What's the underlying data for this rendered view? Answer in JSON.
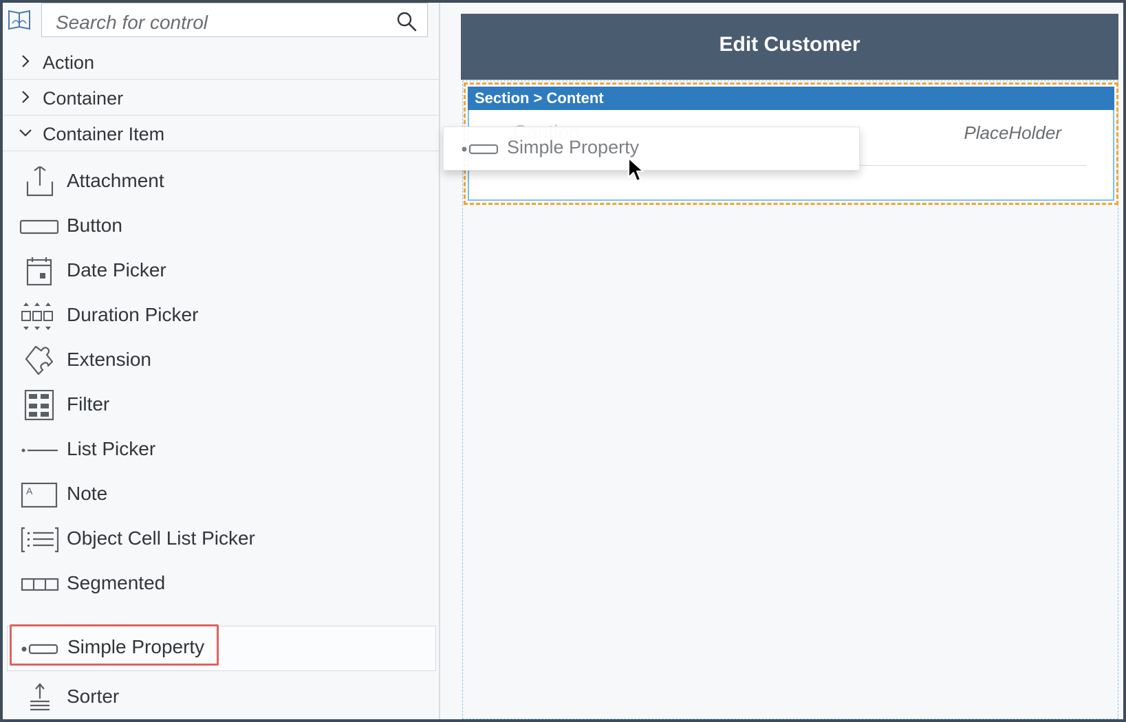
{
  "search": {
    "placeholder": "Search for control"
  },
  "categories": [
    {
      "label": "Action",
      "expanded": false
    },
    {
      "label": "Container",
      "expanded": false
    },
    {
      "label": "Container Item",
      "expanded": true
    }
  ],
  "items": [
    {
      "label": "Attachment",
      "icon": "upload-icon"
    },
    {
      "label": "Button",
      "icon": "button-icon"
    },
    {
      "label": "Date Picker",
      "icon": "calendar-icon"
    },
    {
      "label": "Duration Picker",
      "icon": "duration-picker-icon"
    },
    {
      "label": "Extension",
      "icon": "puzzle-icon"
    },
    {
      "label": "Filter",
      "icon": "grid-icon"
    },
    {
      "label": "List Picker",
      "icon": "list-picker-icon"
    },
    {
      "label": "Note",
      "icon": "note-icon"
    },
    {
      "label": "Object Cell List Picker",
      "icon": "object-cell-list-icon"
    },
    {
      "label": "Segmented",
      "icon": "segmented-icon"
    },
    {
      "label": "Simple Property",
      "icon": "simple-property-icon",
      "selected": true
    },
    {
      "label": "Sorter",
      "icon": "sorter-icon"
    }
  ],
  "canvas": {
    "title": "Edit Customer",
    "section_breadcrumb": "Section > Content",
    "caption": "Caption",
    "placeholder": "PlaceHolder",
    "drag_label": "Simple Property"
  },
  "colors": {
    "header": "#4a5c70",
    "section_bar": "#2f7bbf",
    "drop_outline": "#f0a534",
    "selection_highlight": "#e0625f"
  }
}
